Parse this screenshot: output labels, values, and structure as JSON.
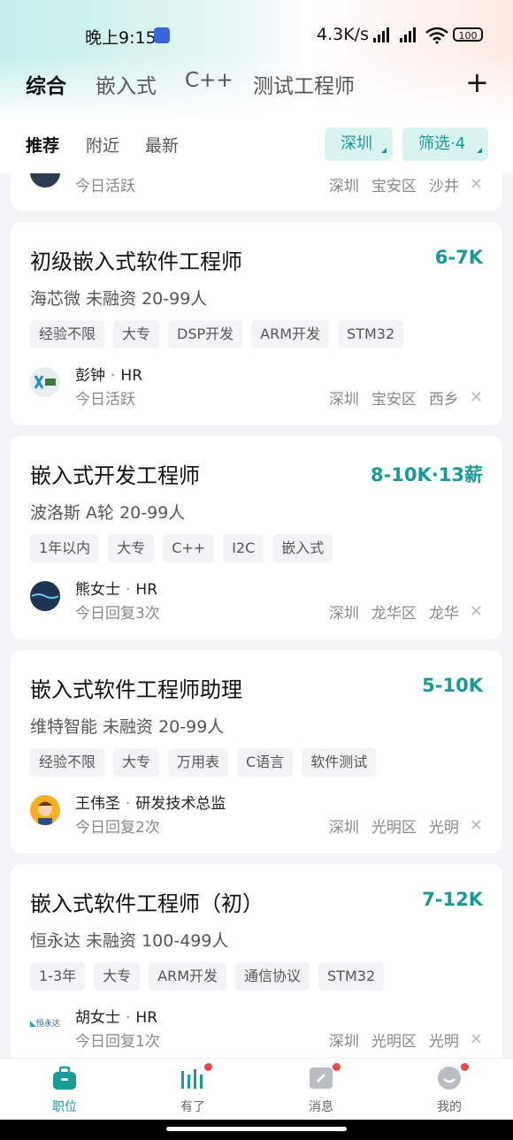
{
  "status_bar": {
    "time": "晚上9:15",
    "network_speed": "4.3K/s",
    "battery": "100"
  },
  "top_tabs": [
    "综合",
    "嵌入式",
    "C++",
    "测试工程师"
  ],
  "sub_tabs": [
    "推荐",
    "附近",
    "最新"
  ],
  "filters": {
    "city": "深圳",
    "screen": "筛选·4"
  },
  "partial_card": {
    "activity": "今日活跃",
    "location": [
      "深圳",
      "宝安区",
      "沙井"
    ]
  },
  "jobs": [
    {
      "title": "初级嵌入式软件工程师",
      "salary": "6-7K",
      "company": "海芯微  未融资  20-99人",
      "tags": [
        "经验不限",
        "大专",
        "DSP开发",
        "ARM开发",
        "STM32"
      ],
      "recruiter": "彭钟",
      "role": "HR",
      "activity": "今日活跃",
      "location": [
        "深圳",
        "宝安区",
        "西乡"
      ]
    },
    {
      "title": "嵌入式开发工程师",
      "salary": "8-10K·13薪",
      "company": "波洛斯  A轮  20-99人",
      "tags": [
        "1年以内",
        "大专",
        "C++",
        "I2C",
        "嵌入式"
      ],
      "recruiter": "熊女士",
      "role": "HR",
      "activity": "今日回复3次",
      "location": [
        "深圳",
        "龙华区",
        "龙华"
      ]
    },
    {
      "title": "嵌入式软件工程师助理",
      "salary": "5-10K",
      "company": "维特智能  未融资  20-99人",
      "tags": [
        "经验不限",
        "大专",
        "万用表",
        "C语言",
        "软件测试"
      ],
      "recruiter": "王伟圣",
      "role": "研发技术总监",
      "activity": "今日回复2次",
      "location": [
        "深圳",
        "光明区",
        "光明"
      ]
    },
    {
      "title": "嵌入式软件工程师（初）",
      "salary": "7-12K",
      "company": "恒永达  未融资  100-499人",
      "tags": [
        "1-3年",
        "大专",
        "ARM开发",
        "通信协议",
        "STM32"
      ],
      "recruiter": "胡女士",
      "role": "HR",
      "activity": "今日回复1次",
      "location": [
        "深圳",
        "光明区",
        "光明"
      ],
      "avatar_text": "恒永达"
    }
  ],
  "bottom_nav": [
    "职位",
    "有了",
    "消息",
    "我的"
  ],
  "colors": {
    "accent": "#1a9a95",
    "badge": "#f04848"
  }
}
